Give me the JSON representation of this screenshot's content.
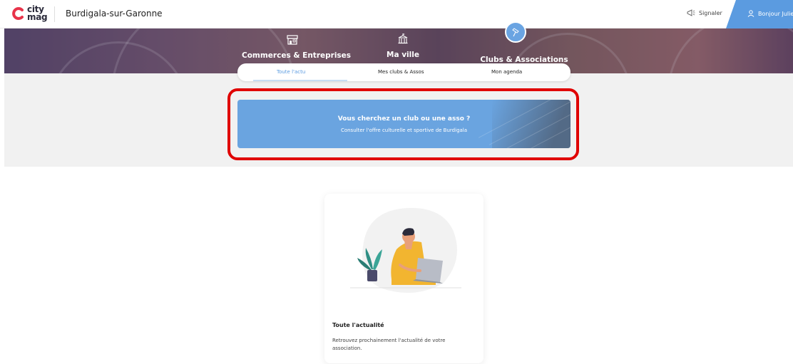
{
  "app": {
    "logo_line1": "city",
    "logo_line2": "mag",
    "city_name": "Burdigala-sur-Garonne",
    "report_label": "Signaler",
    "user_label": "Bonjour Julie"
  },
  "categories": [
    {
      "label": "Commerces & Entreprises",
      "icon": "storefront-icon"
    },
    {
      "label": "Ma ville",
      "icon": "city-hall-icon"
    },
    {
      "label": "Clubs & Associations",
      "icon": "pin-icon",
      "active": true
    }
  ],
  "tabs": [
    {
      "label": "Toute l'actu",
      "active": true
    },
    {
      "label": "Mes clubs & Assos",
      "active": false
    },
    {
      "label": "Mon agenda",
      "active": false
    }
  ],
  "banner": {
    "title": "Vous cherchez un club ou une asso ?",
    "subtitle": "Consulter l'offre culturelle et sportive de Burdigala"
  },
  "card": {
    "title": "Toute l'actualité",
    "text": "Retrouvez prochainement l'actualité de votre association.",
    "illustration": "person-with-laptop-and-plant-illustration"
  },
  "colors": {
    "accent": "#5b9be0",
    "banner": "#6aa4e0",
    "highlight": "#e00000",
    "band": "#f1f1f1"
  }
}
